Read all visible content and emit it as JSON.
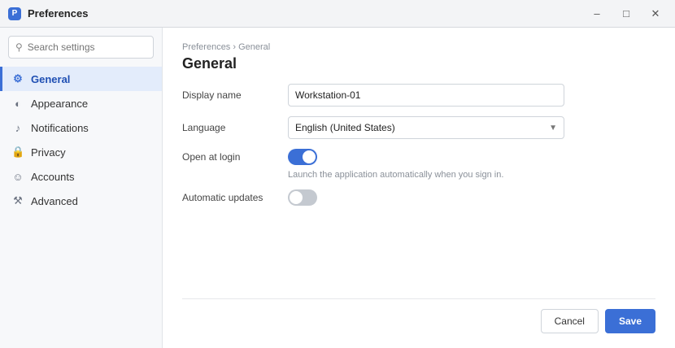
{
  "window": {
    "title": "Preferences",
    "app_icon_glyph": "P"
  },
  "sidebar": {
    "search_placeholder": "Search settings",
    "items": [
      {
        "label": "General",
        "icon": "gear-icon",
        "glyph": "⚙",
        "active": true
      },
      {
        "label": "Appearance",
        "icon": "palette-icon",
        "glyph": "◐",
        "active": false
      },
      {
        "label": "Notifications",
        "icon": "bell-icon",
        "glyph": "♪",
        "active": false
      },
      {
        "label": "Privacy",
        "icon": "lock-icon",
        "glyph": "🔒",
        "active": false
      },
      {
        "label": "Accounts",
        "icon": "user-icon",
        "glyph": "☺",
        "active": false
      },
      {
        "label": "Advanced",
        "icon": "wrench-icon",
        "glyph": "⚒",
        "active": false
      }
    ]
  },
  "main": {
    "breadcrumb": "Preferences › General",
    "title": "General",
    "fields": {
      "display_name_label": "Display name",
      "display_name_value": "Workstation-01",
      "language_label": "Language",
      "language_value": "English (United States)",
      "startup_label": "Open at login",
      "startup_on": true,
      "startup_hint": "Launch the application automatically when you sign in.",
      "updates_label": "Automatic updates",
      "updates_on": false
    }
  },
  "footer": {
    "cancel_label": "Cancel",
    "save_label": "Save"
  },
  "colors": {
    "accent": "#3b6fd6",
    "sidebar_bg": "#f7f8fa"
  }
}
